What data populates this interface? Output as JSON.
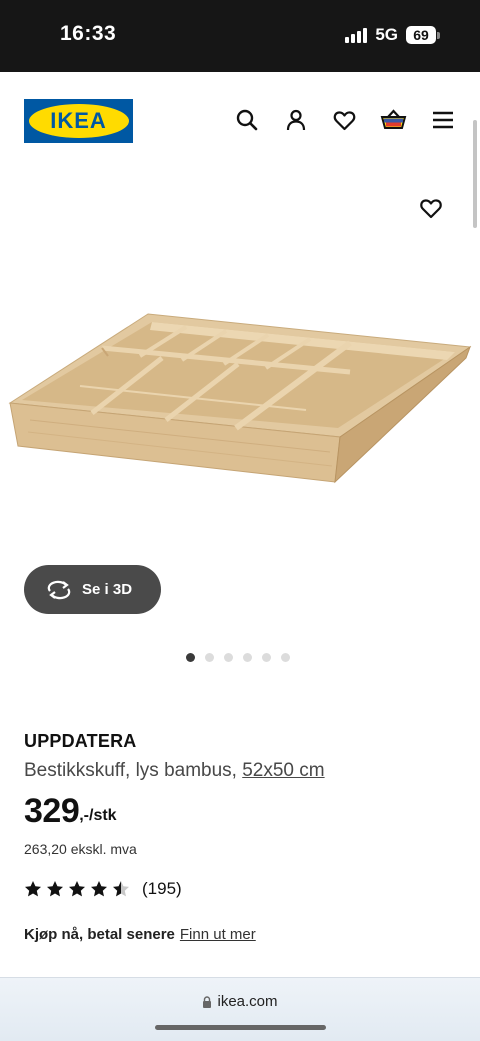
{
  "status_bar": {
    "time": "16:33",
    "network": "5G",
    "battery": "69"
  },
  "header": {
    "logo_text": "IKEA",
    "icons": [
      "search-icon",
      "user-icon",
      "heart-icon",
      "basket-icon",
      "menu-icon"
    ]
  },
  "gallery": {
    "view_3d_label": "Se i 3D",
    "dot_count": 6,
    "active_dot": 0
  },
  "product": {
    "name": "UPPDATERA",
    "description": "Bestikkskuff, lys bambus, ",
    "size": "52x50 cm",
    "price_main": "329",
    "price_unit": ",-/stk",
    "price_ex_vat": "263,20 ekskl. mva",
    "rating": 4.5,
    "review_count": "(195)"
  },
  "klarna": {
    "text": "Kjøp nå, betal senere",
    "link": "Finn ut mer"
  },
  "browser": {
    "url": "ikea.com"
  },
  "colors": {
    "ikea_blue": "#0058a3",
    "ikea_yellow": "#ffdb00",
    "button_3d": "#4a4a4a"
  }
}
